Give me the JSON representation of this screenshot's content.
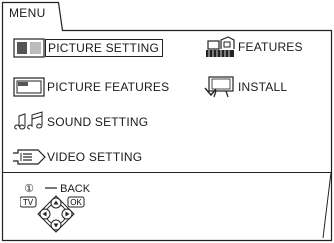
{
  "menu_tab": "MENU",
  "left_items": [
    {
      "label": "PICTURE SETTING",
      "icon": "picture-setting-icon",
      "selected": true
    },
    {
      "label": "PICTURE FEATURES",
      "icon": "picture-features-icon",
      "selected": false
    },
    {
      "label": "SOUND SETTING",
      "icon": "music-notes-icon",
      "selected": false
    },
    {
      "label": "VIDEO SETTING",
      "icon": "video-connector-icon",
      "selected": false
    }
  ],
  "right_items": [
    {
      "label": "FEATURES",
      "icon": "features-icon",
      "selected": false
    },
    {
      "label": "INSTALL",
      "icon": "install-tv-icon",
      "selected": false
    }
  ],
  "footer": {
    "back_label": "BACK",
    "back_symbol": "①",
    "tv_label": "TV",
    "ok_label": "OK"
  }
}
